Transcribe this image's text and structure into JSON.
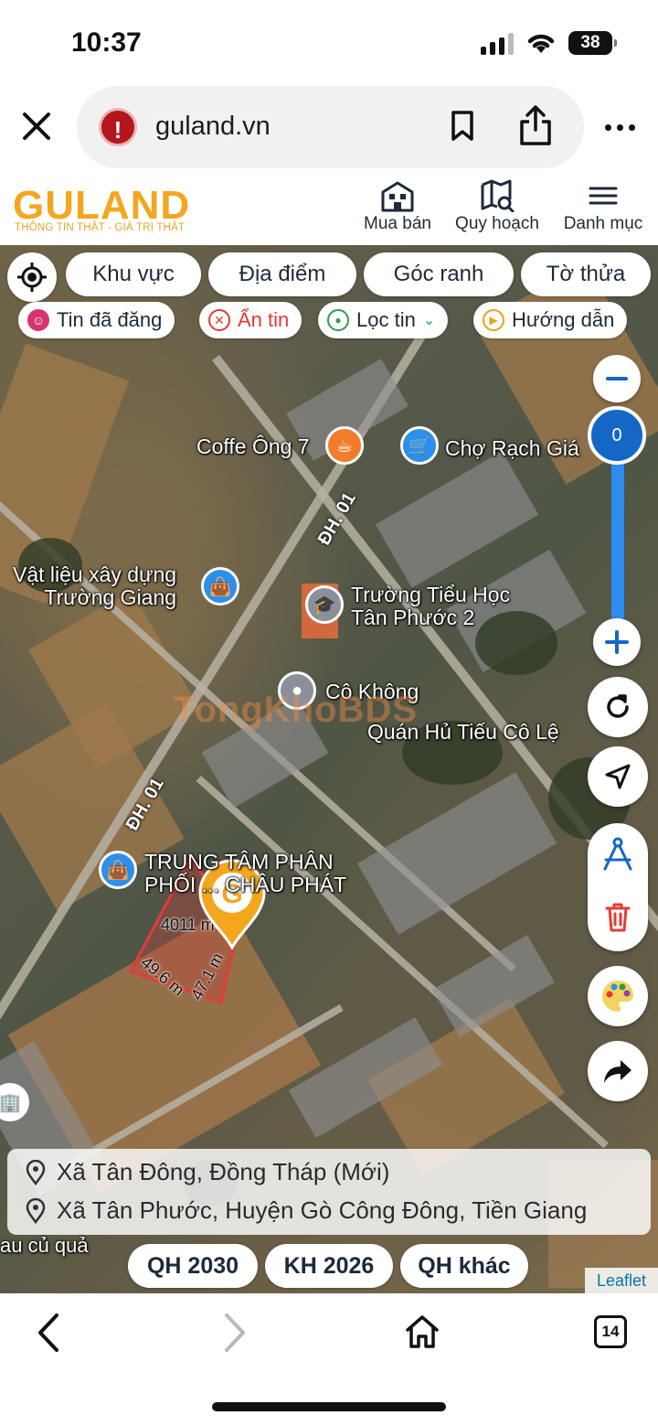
{
  "status": {
    "time": "10:37",
    "battery": "38"
  },
  "browser": {
    "url": "guland.vn"
  },
  "site": {
    "logo": "GULAND",
    "tagline": "THÔNG TIN THẬT - GIÁ TRỊ THẬT",
    "nav": [
      {
        "label": "Mua bán",
        "icon": "building-icon"
      },
      {
        "label": "Quy hoạch",
        "icon": "map-search-icon"
      },
      {
        "label": "Danh mục",
        "icon": "menu-icon"
      }
    ]
  },
  "chips": [
    "Khu vực",
    "Địa điểm",
    "Góc ranh",
    "Tờ thửa"
  ],
  "chips2": [
    {
      "label": "Tin đã đăng",
      "icon": "listing-icon",
      "color": "#d8336d"
    },
    {
      "label": "Ẩn tin",
      "icon": "hide-icon",
      "color": "#e53935"
    },
    {
      "label": "Lọc tin",
      "icon": "filter-pin-icon",
      "color": "#2e9b4e"
    },
    {
      "label": "Hướng dẫn",
      "icon": "guide-icon",
      "color": "#e8a317"
    }
  ],
  "map": {
    "zoom_level": "0",
    "pois": [
      {
        "label": "Coffe Ông 7",
        "color": "#f07c2c"
      },
      {
        "label": "Chợ Rạch Giá",
        "color": "#2c8fe9"
      },
      {
        "label": "Vật liệu xây dựng\nTrường Giang",
        "color": "#2c8fe9"
      },
      {
        "label": "Trường Tiểu Học\nTân Phước 2",
        "color": "#8a8f99"
      },
      {
        "label": "Cô Không",
        "color": "#8a8f99"
      },
      {
        "label": "Quán Hủ Tiếu Cô Lệ",
        "color": "#f07c2c"
      },
      {
        "label": "TRUNG TÂM PHÂN\nPHỐI ... CHÂU PHÁT",
        "color": "#2c8fe9"
      }
    ],
    "roads": [
      "ĐH. 01",
      "ĐH. 01"
    ],
    "parcel": {
      "area": "4011 m²",
      "side_a": "49.6 m",
      "side_b": "47.1 m"
    },
    "watermark": "TongKhoBDS",
    "corner_text": "au củ quả",
    "attribution": "Leaflet"
  },
  "address": {
    "new": "Xã Tân Đông, Đồng Tháp (Mới)",
    "old": "Xã Tân Phước, Huyện Gò Công Đông, Tiền Giang"
  },
  "planning_buttons": [
    "QH 2030",
    "KH 2026",
    "QH khác"
  ],
  "bottom": {
    "tabs": "14"
  }
}
